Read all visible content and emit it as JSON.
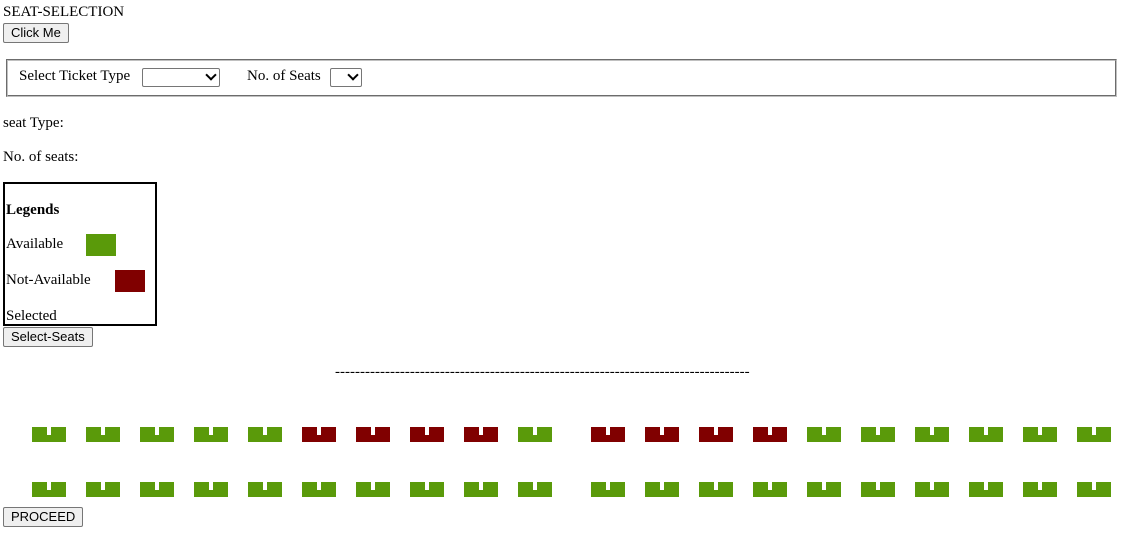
{
  "page_title": "SEAT-SELECTION",
  "click_button_label": "Click Me",
  "form": {
    "ticket_type_label": "Select Ticket Type",
    "ticket_type_value": "",
    "num_seats_label": "No. of Seats",
    "num_seats_value": ""
  },
  "info": {
    "seat_type_label": "seat Type:",
    "num_seats_label": "No. of seats:"
  },
  "legend": {
    "title": "Legends",
    "available_label": "Available",
    "not_available_label": "Not-Available",
    "selected_label": "Selected"
  },
  "colors": {
    "available": "#5a9a0a",
    "not_available": "#800000"
  },
  "select_seats_label": "Select-Seats",
  "divider_text": "-----------------------------------------------------------------------------------",
  "seat_rows": [
    [
      "available",
      "available",
      "available",
      "available",
      "available",
      "not_available",
      "not_available",
      "not_available",
      "not_available",
      "available",
      "not_available",
      "not_available",
      "not_available",
      "not_available",
      "available",
      "available",
      "available",
      "available",
      "available",
      "available"
    ],
    [
      "available",
      "available",
      "available",
      "available",
      "available",
      "available",
      "available",
      "available",
      "available",
      "available",
      "available",
      "available",
      "available",
      "available",
      "available",
      "available",
      "available",
      "available",
      "available",
      "available"
    ]
  ],
  "proceed_label": "PROCEED"
}
